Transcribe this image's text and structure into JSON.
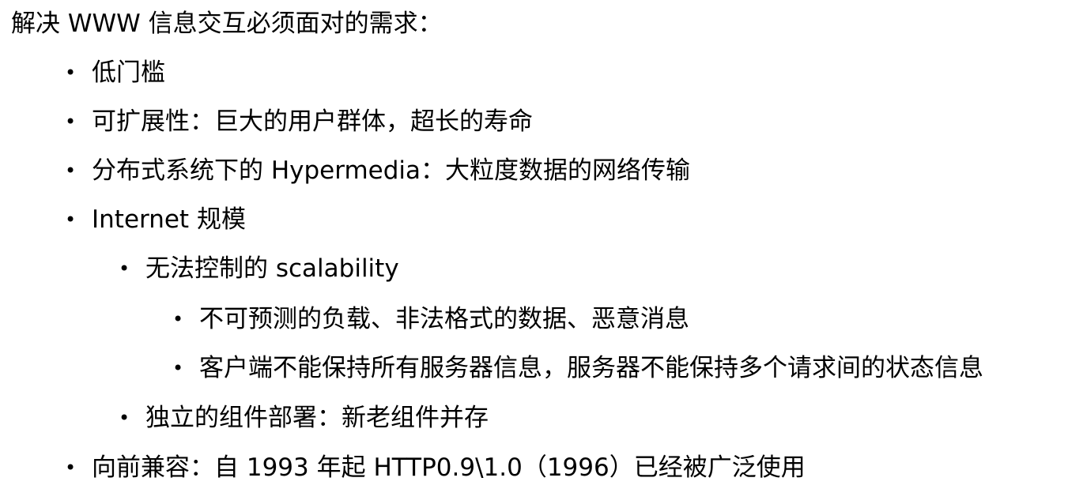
{
  "heading": "解决 WWW 信息交互必须面对的需求：",
  "bullet_glyph": "•",
  "items": [
    {
      "level": 1,
      "text": "低门槛"
    },
    {
      "level": 1,
      "text": "可扩展性：巨大的用户群体，超长的寿命"
    },
    {
      "level": 1,
      "text": "分布式系统下的 Hypermedia：大粒度数据的网络传输"
    },
    {
      "level": 1,
      "text": "Internet 规模"
    },
    {
      "level": 2,
      "text": "无法控制的 scalability"
    },
    {
      "level": 3,
      "text": "不可预测的负载、非法格式的数据、恶意消息"
    },
    {
      "level": 3,
      "text": "客户端不能保持所有服务器信息，服务器不能保持多个请求间的状态信息"
    },
    {
      "level": 2,
      "text": "独立的组件部署：新老组件并存"
    },
    {
      "level": 1,
      "text": "向前兼容：自 1993 年起 HTTP0.9\\1.0（1996）已经被广泛使用"
    }
  ]
}
